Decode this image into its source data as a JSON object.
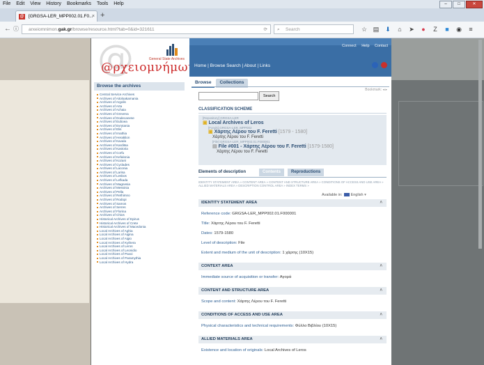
{
  "menu": [
    "File",
    "Edit",
    "View",
    "History",
    "Bookmarks",
    "Tools",
    "Help"
  ],
  "window_controls": [
    "–",
    "□",
    "✕"
  ],
  "tab": {
    "favicon": "@",
    "title": "[GRGSA-LER_MPP002.01.F0...",
    "close": "×",
    "new": "+"
  },
  "nav": {
    "back": "←",
    "info": "ⓘ",
    "url_prefix": "arxeiomnimon.",
    "url_domain": "gak.gr",
    "url_path": "/browse/resource.html?tab=0&id=321611",
    "reload": "⟳",
    "search_placeholder": "Search",
    "search_icon": "⌕"
  },
  "toolbar_icons": [
    {
      "name": "star-icon",
      "glyph": "☆",
      "color": "#444444"
    },
    {
      "name": "reading-list-icon",
      "glyph": "▤",
      "color": "#444444"
    },
    {
      "name": "download-icon",
      "glyph": "⬇",
      "color": "#1e6fbf"
    },
    {
      "name": "home-icon",
      "glyph": "⌂",
      "color": "#444444"
    },
    {
      "name": "send-icon",
      "glyph": "➤",
      "color": "#444444"
    },
    {
      "name": "pocket-icon",
      "glyph": "●",
      "color": "#d63b4e"
    },
    {
      "name": "zotero-icon",
      "glyph": "Z",
      "color": "#444444"
    },
    {
      "name": "extension-icon",
      "glyph": "■",
      "color": "#2f8ad8"
    },
    {
      "name": "sync-icon",
      "glyph": "◉",
      "color": "#333333"
    },
    {
      "name": "menu-icon",
      "glyph": "≡",
      "color": "#333333"
    }
  ],
  "site": {
    "logo_text": "@ρχειομνήμων",
    "logo_subtitle": "General State Archives",
    "top_links": [
      "Connect",
      "Help",
      "Contact"
    ],
    "nav": "Home | Browse  Search | About | Links"
  },
  "sidebar": {
    "title": "Browse the archives",
    "items": [
      "Central Service Archives",
      "Archives of Aitoloakarnania",
      "Archives of Argolis",
      "Archives of Arta",
      "Archives of Achaia",
      "Archives of Grevena",
      "Archives of Dodecanese",
      "Archives of Euboea",
      "Archives of Evrytania",
      "Archives of Elis",
      "Archives of Imathia",
      "Archives of Heraklion",
      "Archives of Kavala",
      "Archives of Karditsa",
      "Archives of Kastoria",
      "Archives of Corfu",
      "Archives of Kefalonia",
      "Archives of Kozani",
      "Archives of Cyclades",
      "Archives of Laconia",
      "Archives of Larisa",
      "Archives of Lesbos",
      "Archives of Lefkada",
      "Archives of Magnesia",
      "Archives of Messinia",
      "Archives of Pella",
      "Archives of Rethimno",
      "Archives of Rodopi",
      "Archives of Samos",
      "Archives of Serres",
      "Archives of Florina",
      "Archives of Chios",
      "Historical Archives of Epirus",
      "Historical Archives of Crete",
      "Historical Archives of Macedonia",
      "Local Archives of Aghia",
      "Local Archives of Aigina",
      "Local Archives of Aigio",
      "Local Archives of Kythera",
      "Local Archives of Leros",
      "Local Archives of Leonidio",
      "Local Archives of Paxoi",
      "Local Archives of Paramythia",
      "Local Archives of Hydra"
    ]
  },
  "main": {
    "tabs": [
      "Browse",
      "Collections"
    ],
    "search_button": "Search",
    "bookmark": "Bookmark: ◂ ▸",
    "classification_title": "CLASSIFICATION SCHEME",
    "tree": {
      "repo": "[Repository] GRGSA-LER",
      "archive": "Local Archives of Leros",
      "fonds_code": "[Fonds] GRGSA-LER_MPP002",
      "fonds_title": "Χάρτης Λέρου του F. Feretti",
      "fonds_dates": "[1579 - 1580]",
      "fonds_sub": "Χάρτης Λέρου του F. Feretti",
      "file_code": "[File] GRGSA-LER_MPP002.01.F000001",
      "file_title": "File #001 - Χάρτης Λέρου του F. Feretti",
      "file_dates": "[1579-1580]",
      "file_sub": "Χάρτης Λέρου του F. Feretti"
    },
    "element_tabs": [
      "Elements of description",
      "Contents",
      "Reproductions"
    ],
    "crumbs": "IDENTITY STATEMENT AREA »  CONTENT AREA »  CONTENT AND STRUCTURE AREA »  CONDITIONS OF ACCESS AND USE AREA »  ALLIED MATERIALS AREA »  DESCRIPTION CONTROL AREA »  INDEX TERMS »",
    "available_in": "Available in:",
    "language": "English",
    "sections": [
      {
        "title": "IDENTITY STATEMENT AREA",
        "fields": [
          {
            "k": "Reference code:",
            "v": "GRGSA-LER_MPP002.01.F000001"
          },
          {
            "k": "Title:",
            "v": "Χάρτης Λέρου του F. Feretti"
          },
          {
            "k": "Dates:",
            "v": "1579-1580"
          },
          {
            "k": "Level of description:",
            "v": "File"
          },
          {
            "k": "Extent and medium of the unit of description:",
            "v": "1 χάρτης (10X15)"
          }
        ]
      },
      {
        "title": "CONTEXT AREA",
        "fields": [
          {
            "k": "Immediate source of acquisition or transfer:",
            "v": "Αγορά"
          }
        ]
      },
      {
        "title": "CONTENT AND STRUCTURE AREA",
        "fields": [
          {
            "k": "Scope and content:",
            "v": "Χάρτης Λέρου του F. Feretti"
          }
        ]
      },
      {
        "title": "CONDITIONS OF ACCESS AND USE AREA",
        "fields": [
          {
            "k": "Physical characteristics and technical requirements:",
            "v": "Φύλλο Βιβλίου (10X15)"
          }
        ]
      },
      {
        "title": "ALLIED MATERIALS AREA",
        "fields": [
          {
            "k": "Existence and location of originals:",
            "v": "Local Archives of Leros"
          }
        ]
      }
    ]
  }
}
